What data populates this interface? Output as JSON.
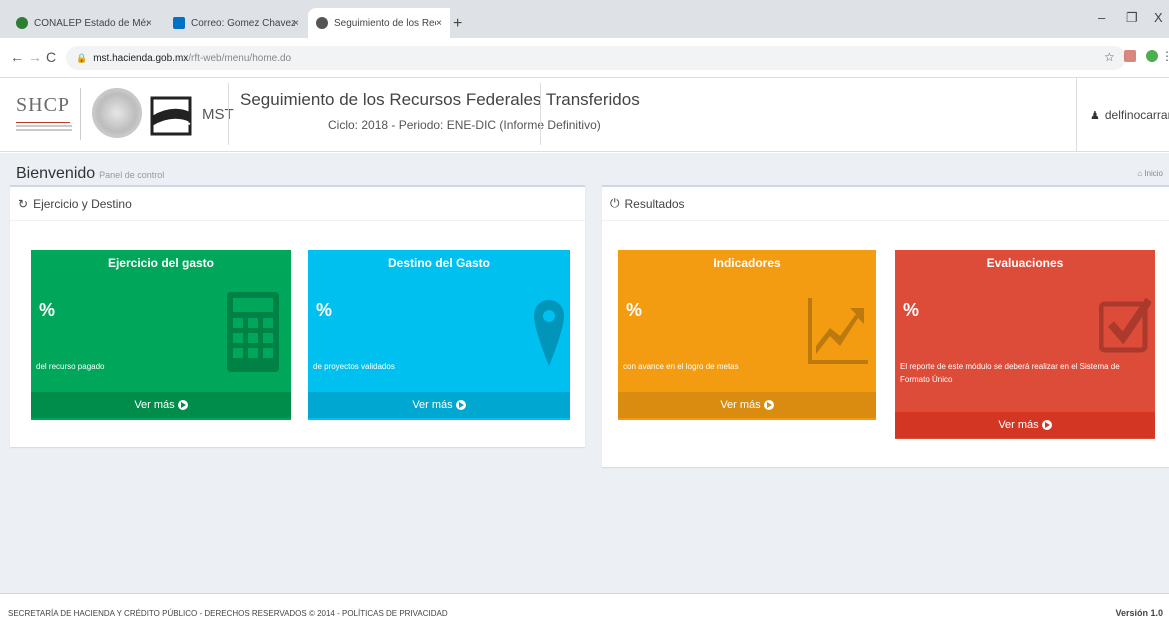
{
  "browser": {
    "tabs": [
      {
        "label": "CONALEP Estado de México",
        "close": "×"
      },
      {
        "label": "Correo: Gomez Chavez Dolores",
        "close": "×"
      },
      {
        "label": "Seguimiento de los Recursos Fe",
        "close": "×"
      }
    ],
    "new_tab": "+",
    "window_controls": {
      "minimize": "–",
      "maximize": "❐",
      "close": "X"
    },
    "url_host": "mst.hacienda.gob.mx",
    "url_path": "/rft-web/menu/home.do",
    "nav": {
      "back": "←",
      "forward": "→",
      "reload": "C"
    }
  },
  "header": {
    "org_logo_text": "SHCP",
    "mst_text": "MST",
    "title": "Seguimiento de los Recursos Federales Transferidos",
    "subtitle": "Ciclo: 2018 - Periodo: ENE-DIC (Informe Definitivo)",
    "user": "delfinocarranzac"
  },
  "page": {
    "welcome": "Bienvenido",
    "welcome_sub": "Panel de control",
    "breadcrumb": "Inicio"
  },
  "panels": {
    "left": {
      "title": "Ejercicio y Destino",
      "cards": [
        {
          "title": "Ejercicio del gasto",
          "percent": "%",
          "desc": "del recurso pagado",
          "more": "Ver más",
          "color": "#00a65a",
          "foot_color": "#008d4c"
        },
        {
          "title": "Destino del Gasto",
          "percent": "%",
          "desc": "de proyectos validados",
          "more": "Ver más",
          "color": "#00c0ef",
          "foot_color": "#00a7d0"
        }
      ]
    },
    "right": {
      "title": "Resultados",
      "cards": [
        {
          "title": "Indicadores",
          "percent": "%",
          "desc": "con avance en el logro de metas",
          "more": "Ver más",
          "color": "#f39c12",
          "foot_color": "#da8c10"
        },
        {
          "title": "Evaluaciones",
          "percent": "%",
          "desc": "El reporte de este módulo se deberá realizar en el Sistema de Formato Único",
          "more": "Ver más",
          "color": "#dd4b39",
          "foot_color": "#d33724"
        }
      ]
    }
  },
  "footer": {
    "left": "SECRETARÍA DE HACIENDA Y CRÉDITO PÚBLICO - DERECHOS RESERVADOS © 2014 - POLÍTICAS DE PRIVACIDAD",
    "right": "Versión 1.0"
  }
}
